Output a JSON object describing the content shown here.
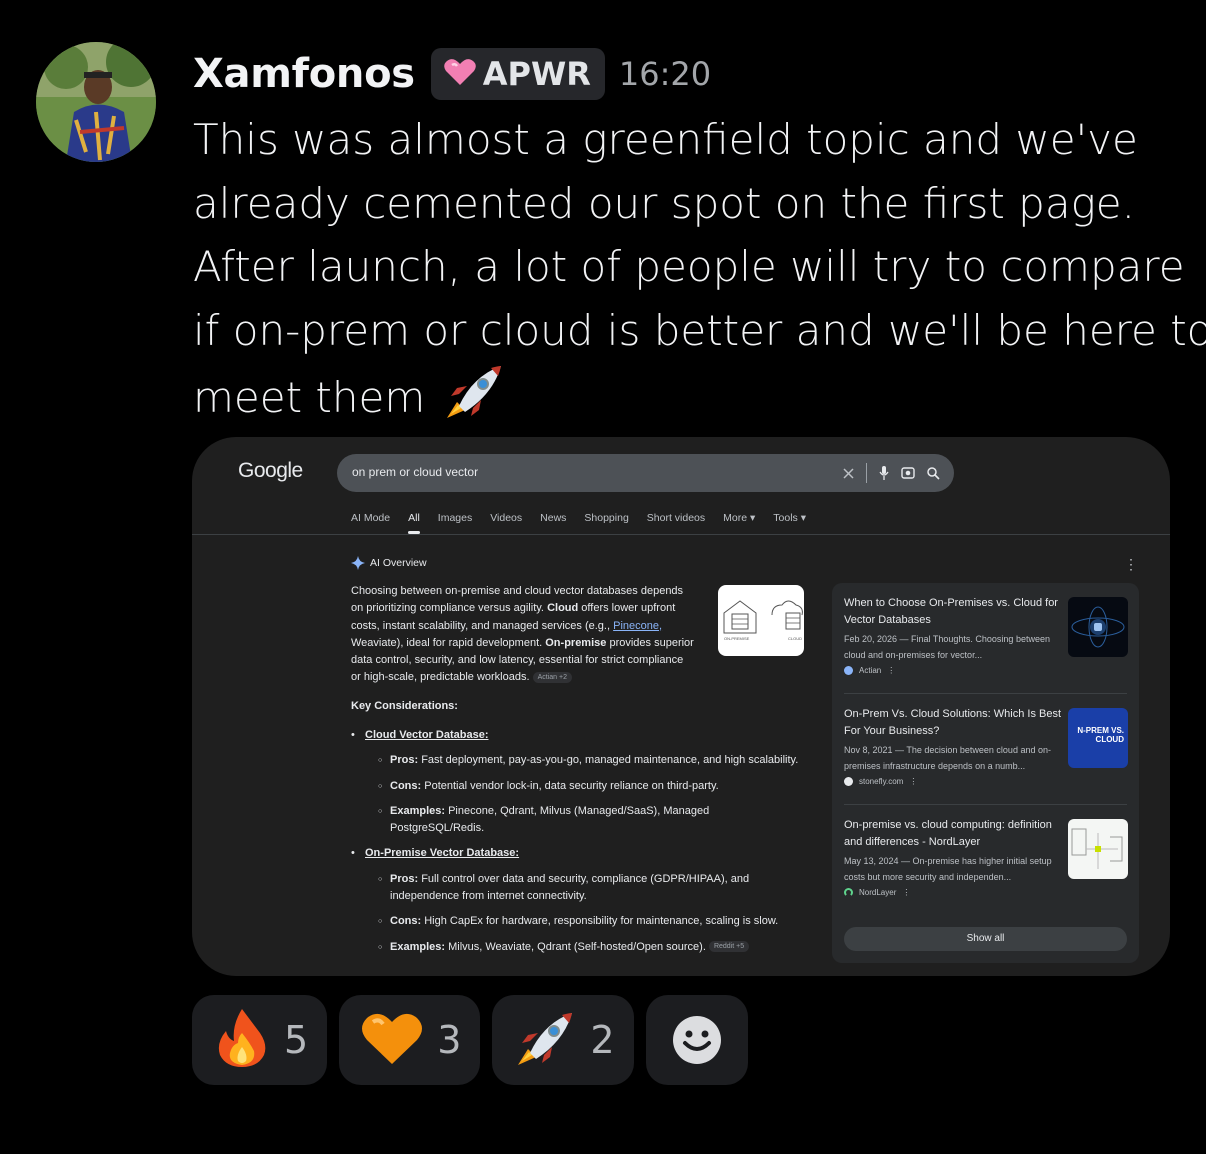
{
  "message": {
    "username": "Xamfonos",
    "tag": {
      "label": "APWR",
      "icon": "pink-heart-icon"
    },
    "timestamp": "16:20",
    "lines": [
      "This was almost a greenfield topic and we've",
      "already cemented our spot on the first page.",
      "After launch, a lot of people will try to compare",
      "if on-prem or cloud is better and we'll be here to",
      "meet them"
    ],
    "trailing_emoji": "rocket"
  },
  "screenshot": {
    "logo": "Google",
    "search_query": "on prem or cloud vector",
    "tabs": [
      "AI Mode",
      "All",
      "Images",
      "Videos",
      "News",
      "Shopping",
      "Short videos",
      "More ▾",
      "Tools ▾"
    ],
    "active_tab": "All",
    "ai_overview": {
      "label": "AI Overview",
      "intro_lines": [
        "Choosing between on-premise and cloud vector databases depends",
        "on prioritizing compliance versus agility.",
        "Cloud",
        "offers lower upfront",
        "costs, instant scalability, and managed services (e.g.,",
        "Pinecone,",
        "Weaviate), ideal for rapid development.",
        "On-premise",
        "provides superior",
        "data control, security, and low latency, essential for strict compliance",
        "or high-scale, predictable workloads."
      ],
      "intro_chip": "Actian +2",
      "image_labels": [
        "ON-PREMISE",
        "CLOUD"
      ],
      "key_considerations": "Key Considerations:",
      "groups": [
        {
          "title": "Cloud Vector Database:",
          "items": [
            {
              "label": "Pros:",
              "text": "Fast deployment, pay-as-you-go, managed maintenance, and high scalability."
            },
            {
              "label": "Cons:",
              "text": "Potential vendor lock-in, data security reliance on third-party."
            },
            {
              "label": "Examples:",
              "text": "Pinecone, Qdrant, Milvus (Managed/SaaS), Managed PostgreSQL/Redis."
            }
          ]
        },
        {
          "title": "On-Premise Vector Database:",
          "items": [
            {
              "label": "Pros:",
              "text": "Full control over data and security, compliance (GDPR/HIPAA), and independence from internet connectivity."
            },
            {
              "label": "Cons:",
              "text": "High CapEx for hardware, responsibility for maintenance, scaling is slow."
            },
            {
              "label": "Examples:",
              "text": "Milvus, Weaviate, Qdrant (Self-hosted/Open source)."
            }
          ]
        }
      ],
      "last_chip": "Reddit +5"
    },
    "sources": [
      {
        "title": "When to Choose On-Premises vs. Cloud for Vector Databases",
        "snippet": "Feb 20, 2026 — Final Thoughts. Choosing between cloud and on-premises for vector...",
        "site": "Actian"
      },
      {
        "title": "On-Prem Vs. Cloud Solutions: Which Is Best For Your Business?",
        "snippet": "Nov 8, 2021 — The decision between cloud and on-premises infrastructure depends on a numb...",
        "site": "stonefly.com",
        "thumb_text": "N-PREM VS. CLOUD"
      },
      {
        "title": "On-premise vs. cloud computing: definition and differences - NordLayer",
        "snippet": "May 13, 2024 — On-premise has higher initial setup costs but more security and independen...",
        "site": "NordLayer"
      }
    ],
    "show_all": "Show all"
  },
  "reactions": [
    {
      "emoji": "fire",
      "count": "5"
    },
    {
      "emoji": "orange-heart",
      "count": "3"
    },
    {
      "emoji": "rocket",
      "count": "2"
    }
  ]
}
